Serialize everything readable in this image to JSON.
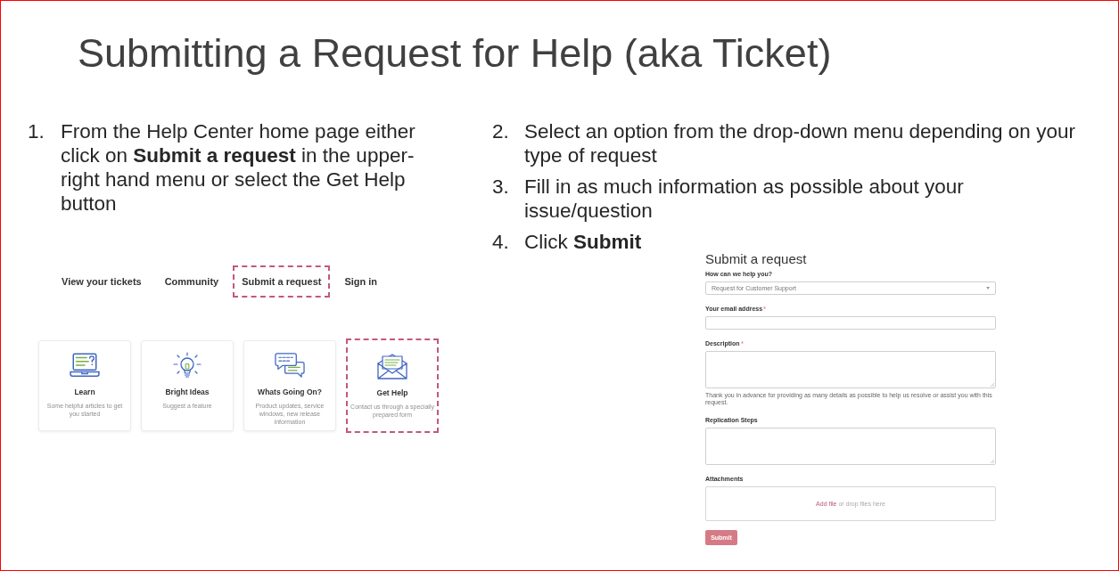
{
  "slide": {
    "title": "Submitting a Request for Help (aka Ticket)"
  },
  "steps_left": [
    {
      "number": "1.",
      "text": "From the Help Center home page either click on **Submit a request** in the upper-right hand menu or select the Get Help button"
    }
  ],
  "help_center": {
    "nav": [
      {
        "label": "View your tickets",
        "highlighted": false
      },
      {
        "label": "Community",
        "highlighted": false
      },
      {
        "label": "Submit a request",
        "highlighted": true
      },
      {
        "label": "Sign in",
        "highlighted": false
      }
    ],
    "cards": [
      {
        "kind": "laptop",
        "title": "Learn",
        "description": "Some helpful articles to get you started",
        "highlighted": false
      },
      {
        "kind": "lightbulb",
        "title": "Bright Ideas",
        "description": "Suggest a feature",
        "highlighted": false
      },
      {
        "kind": "chat",
        "title": "Whats Going On?",
        "description": "Product updates, service windows, new release information",
        "highlighted": false
      },
      {
        "kind": "envelope",
        "title": "Get Help",
        "description": "Contact us through a specially prepared form",
        "highlighted": true
      }
    ]
  },
  "steps_right": [
    {
      "number": "2.",
      "text": "Select an option from the drop-down menu depending on your type of request"
    },
    {
      "number": "3.",
      "text": "Fill in as much information as possible about your issue/question"
    },
    {
      "number": "4.",
      "text": "Click **Submit**"
    }
  ],
  "request_form": {
    "title": "Submit a request",
    "fields": [
      {
        "kind": "select",
        "label": "How can we help you?",
        "required": false,
        "value": "Request for Customer Support"
      },
      {
        "kind": "text",
        "label": "Your email address",
        "required": true
      },
      {
        "kind": "textarea",
        "label": "Description",
        "required": true,
        "help_text": "Thank you in advance for providing as many details as possible to help us resolve or assist you with this request."
      },
      {
        "kind": "textarea",
        "label": "Replication Steps",
        "required": false
      },
      {
        "kind": "dropzone",
        "label": "Attachments",
        "required": false,
        "link": "Add file",
        "text": "or drop files here"
      }
    ],
    "submit": "Submit"
  }
}
